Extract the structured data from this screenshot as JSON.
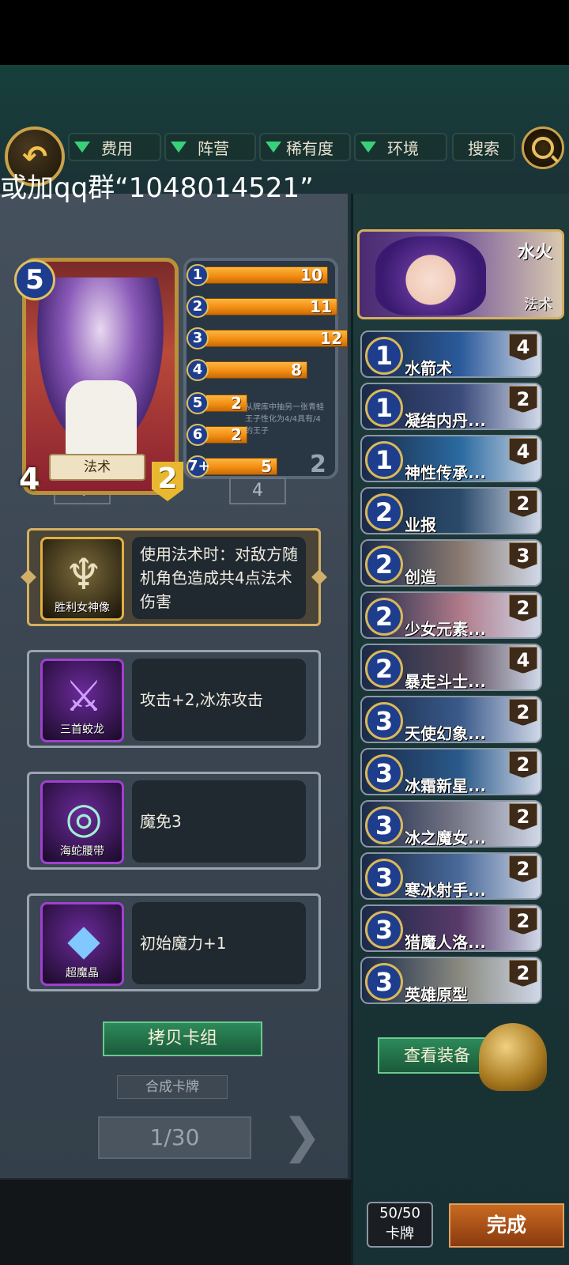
{
  "overlay_text": "或加qq群“1048014521”",
  "filters": [
    "费用",
    "阵营",
    "稀有度",
    "环境"
  ],
  "search_label": "搜索",
  "hero": {
    "cost": "5",
    "type": "法术",
    "attack": "4",
    "health": "2"
  },
  "back_card_values": {
    "left": "4",
    "right": "4",
    "right_side": "2"
  },
  "mana_curve": [
    {
      "cost": "1",
      "count": 10
    },
    {
      "cost": "2",
      "count": 11
    },
    {
      "cost": "3",
      "count": 12
    },
    {
      "cost": "4",
      "count": 8
    },
    {
      "cost": "5",
      "count": 2
    },
    {
      "cost": "6",
      "count": 2
    },
    {
      "cost": "7+",
      "count": 5
    }
  ],
  "curve_desc": "从牌库中抽另一张青蛙王子性化为4/4具有/4的王子",
  "equipment": [
    {
      "name": "胜利女神像",
      "desc": "使用法术时：对敌方随机角色造成共4点法术伤害",
      "icon": "victory-statue-icon"
    },
    {
      "name": "三首蛟龙",
      "desc": "攻击+2,冰冻攻击",
      "icon": "hydra-spear-icon"
    },
    {
      "name": "海蛇腰带",
      "desc": "魔免3",
      "icon": "serpent-belt-icon"
    },
    {
      "name": "超魔晶",
      "desc": "初始魔力+1",
      "icon": "mana-crystal-icon"
    }
  ],
  "copy_deck_label": "拷贝卡组",
  "compose_label": "合成卡牌",
  "page_counter": "1/30",
  "deck_hero": {
    "name": "水火",
    "type": "法术"
  },
  "deck_cards": [
    {
      "cost": "1",
      "name": "水箭术",
      "count": "4"
    },
    {
      "cost": "1",
      "name": "凝结内丹...",
      "count": "2"
    },
    {
      "cost": "1",
      "name": "神性传承...",
      "count": "4"
    },
    {
      "cost": "2",
      "name": "业报",
      "count": "2"
    },
    {
      "cost": "2",
      "name": "创造",
      "count": "3"
    },
    {
      "cost": "2",
      "name": "少女元素...",
      "count": "2"
    },
    {
      "cost": "2",
      "name": "暴走斗士...",
      "count": "4"
    },
    {
      "cost": "3",
      "name": "天使幻象...",
      "count": "2"
    },
    {
      "cost": "3",
      "name": "冰霜新星...",
      "count": "2"
    },
    {
      "cost": "3",
      "name": "冰之魔女...",
      "count": "2"
    },
    {
      "cost": "3",
      "name": "寒冰射手...",
      "count": "2"
    },
    {
      "cost": "3",
      "name": "猎魔人洛...",
      "count": "2"
    },
    {
      "cost": "3",
      "name": "英雄原型",
      "count": "2"
    }
  ],
  "view_equipment_label": "查看装备",
  "deck_count": {
    "value": "50/50",
    "unit": "卡牌"
  },
  "done_label": "完成",
  "colors": {
    "accent_gold": "#d4b060",
    "button_green": "#2d8a5a",
    "done_orange": "#c86a20",
    "mana_blue": "#1e3d8c"
  }
}
